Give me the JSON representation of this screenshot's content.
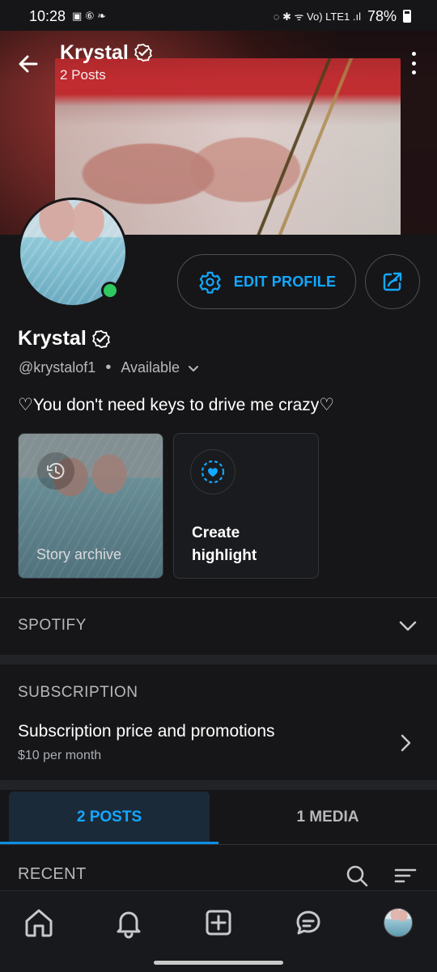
{
  "status": {
    "time": "10:28",
    "left_icons": "▣ ⑥ ❧",
    "right_icons": "◌ ✱ ᯤ Vo) LTE1 .ıl",
    "battery": "78%"
  },
  "header": {
    "name": "Krystal",
    "posts": "2 Posts"
  },
  "profile": {
    "name": "Krystal",
    "handle": "@krystalof1",
    "separator": "•",
    "availability": "Available",
    "bio": "♡You don't need keys to drive me crazy♡",
    "edit_label": "EDIT PROFILE",
    "online": true,
    "accent_color": "#12a8ff",
    "online_color": "#2ec95f"
  },
  "stories": {
    "archive_label": "Story archive",
    "create_label": "Create\nhighlight"
  },
  "sections": {
    "spotify": "SPOTIFY",
    "subscription_title": "SUBSCRIPTION",
    "subscription_item": "Subscription price and promotions",
    "subscription_price": "$10 per month"
  },
  "tabs": [
    {
      "label": "2 POSTS",
      "active": true
    },
    {
      "label": "1 MEDIA",
      "active": false
    }
  ],
  "recent": {
    "title": "RECENT"
  },
  "nav": {
    "items": [
      "home-icon",
      "bell-icon",
      "add-icon",
      "messages-icon",
      "profile-avatar"
    ]
  }
}
